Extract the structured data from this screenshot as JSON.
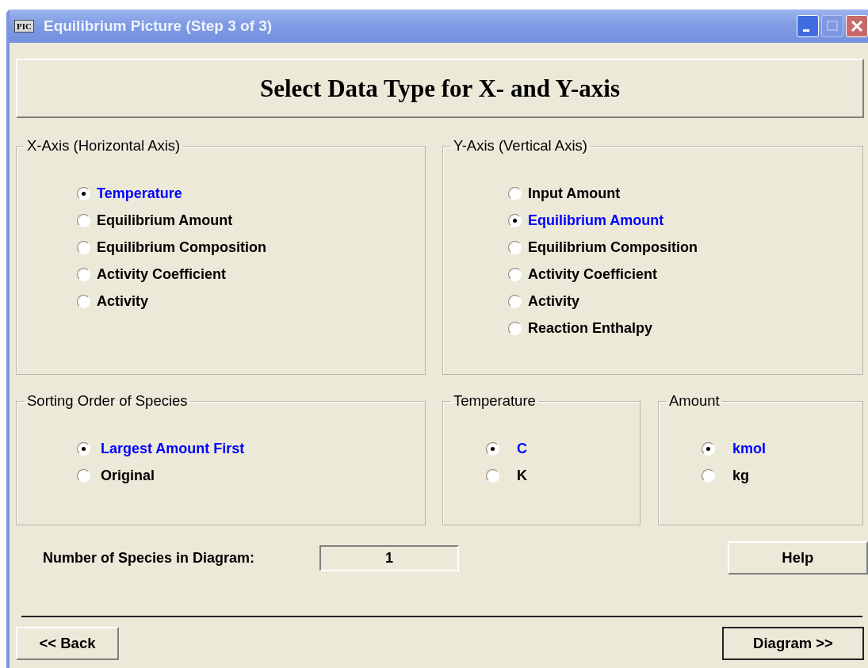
{
  "window": {
    "title": "Equilibrium Picture (Step 3 of 3)",
    "icon_text": "PIC"
  },
  "heading": "Select Data Type for X- and Y-axis",
  "groups": [
    {
      "title": "X-Axis (Horizontal Axis)",
      "options": [
        {
          "label": "Temperature",
          "selected": true
        },
        {
          "label": "Equilibrium Amount",
          "selected": false
        },
        {
          "label": "Equilibrium Composition",
          "selected": false
        },
        {
          "label": "Activity Coefficient",
          "selected": false
        },
        {
          "label": "Activity",
          "selected": false
        }
      ]
    },
    {
      "title": "Y-Axis (Vertical Axis)",
      "options": [
        {
          "label": "Input Amount",
          "selected": false
        },
        {
          "label": "Equilibrium Amount",
          "selected": true
        },
        {
          "label": "Equilibrium Composition",
          "selected": false
        },
        {
          "label": "Activity Coefficient",
          "selected": false
        },
        {
          "label": "Activity",
          "selected": false
        },
        {
          "label": "Reaction Enthalpy",
          "selected": false
        }
      ]
    },
    {
      "title": "Sorting Order of Species",
      "options": [
        {
          "label": "Largest Amount First",
          "selected": true
        },
        {
          "label": "Original",
          "selected": false
        }
      ]
    },
    {
      "title": "Temperature",
      "options": [
        {
          "label": "C",
          "selected": true
        },
        {
          "label": "K",
          "selected": false
        }
      ]
    },
    {
      "title": "Amount",
      "options": [
        {
          "label": "kmol",
          "selected": true
        },
        {
          "label": "kg",
          "selected": false
        }
      ]
    }
  ],
  "species_count": {
    "label": "Number of Species in Diagram:",
    "value": "1"
  },
  "buttons": {
    "help": "Help",
    "back": "<< Back",
    "next": "Diagram >>"
  }
}
